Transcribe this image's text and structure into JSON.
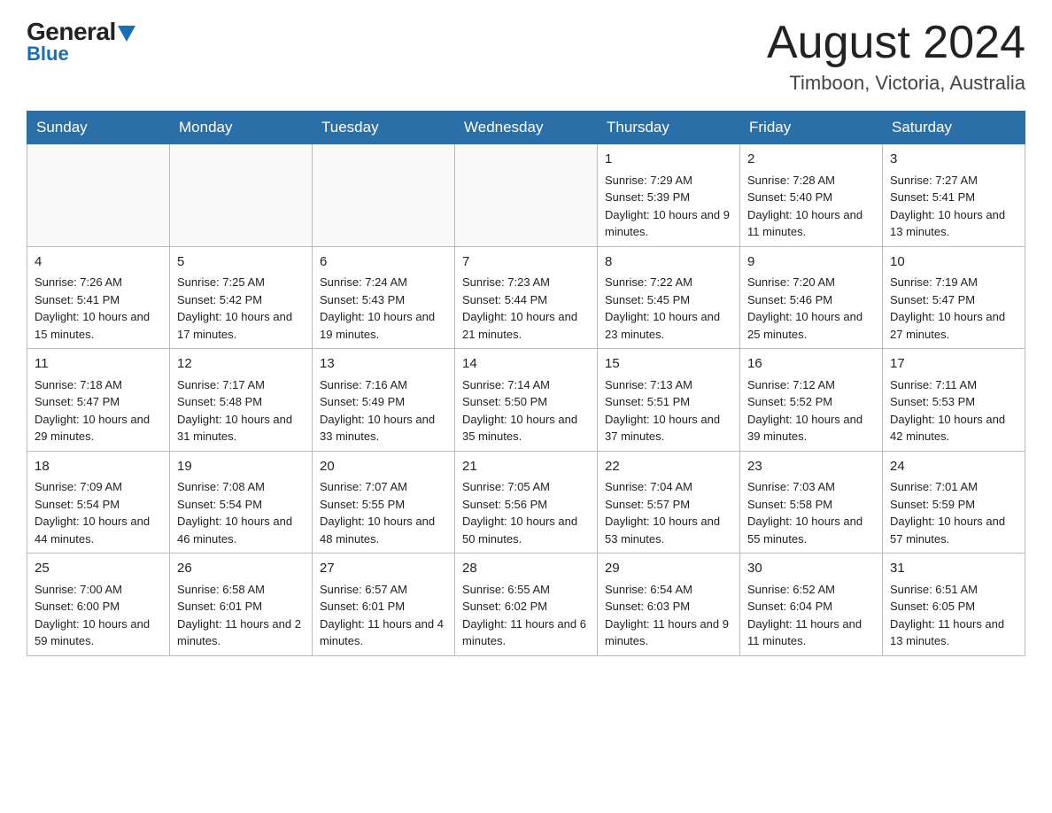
{
  "header": {
    "logo_general": "General",
    "logo_blue": "Blue",
    "month_title": "August 2024",
    "location": "Timboon, Victoria, Australia"
  },
  "days_of_week": [
    "Sunday",
    "Monday",
    "Tuesday",
    "Wednesday",
    "Thursday",
    "Friday",
    "Saturday"
  ],
  "weeks": [
    [
      {
        "day": "",
        "info": ""
      },
      {
        "day": "",
        "info": ""
      },
      {
        "day": "",
        "info": ""
      },
      {
        "day": "",
        "info": ""
      },
      {
        "day": "1",
        "info": "Sunrise: 7:29 AM\nSunset: 5:39 PM\nDaylight: 10 hours and 9 minutes."
      },
      {
        "day": "2",
        "info": "Sunrise: 7:28 AM\nSunset: 5:40 PM\nDaylight: 10 hours and 11 minutes."
      },
      {
        "day": "3",
        "info": "Sunrise: 7:27 AM\nSunset: 5:41 PM\nDaylight: 10 hours and 13 minutes."
      }
    ],
    [
      {
        "day": "4",
        "info": "Sunrise: 7:26 AM\nSunset: 5:41 PM\nDaylight: 10 hours and 15 minutes."
      },
      {
        "day": "5",
        "info": "Sunrise: 7:25 AM\nSunset: 5:42 PM\nDaylight: 10 hours and 17 minutes."
      },
      {
        "day": "6",
        "info": "Sunrise: 7:24 AM\nSunset: 5:43 PM\nDaylight: 10 hours and 19 minutes."
      },
      {
        "day": "7",
        "info": "Sunrise: 7:23 AM\nSunset: 5:44 PM\nDaylight: 10 hours and 21 minutes."
      },
      {
        "day": "8",
        "info": "Sunrise: 7:22 AM\nSunset: 5:45 PM\nDaylight: 10 hours and 23 minutes."
      },
      {
        "day": "9",
        "info": "Sunrise: 7:20 AM\nSunset: 5:46 PM\nDaylight: 10 hours and 25 minutes."
      },
      {
        "day": "10",
        "info": "Sunrise: 7:19 AM\nSunset: 5:47 PM\nDaylight: 10 hours and 27 minutes."
      }
    ],
    [
      {
        "day": "11",
        "info": "Sunrise: 7:18 AM\nSunset: 5:47 PM\nDaylight: 10 hours and 29 minutes."
      },
      {
        "day": "12",
        "info": "Sunrise: 7:17 AM\nSunset: 5:48 PM\nDaylight: 10 hours and 31 minutes."
      },
      {
        "day": "13",
        "info": "Sunrise: 7:16 AM\nSunset: 5:49 PM\nDaylight: 10 hours and 33 minutes."
      },
      {
        "day": "14",
        "info": "Sunrise: 7:14 AM\nSunset: 5:50 PM\nDaylight: 10 hours and 35 minutes."
      },
      {
        "day": "15",
        "info": "Sunrise: 7:13 AM\nSunset: 5:51 PM\nDaylight: 10 hours and 37 minutes."
      },
      {
        "day": "16",
        "info": "Sunrise: 7:12 AM\nSunset: 5:52 PM\nDaylight: 10 hours and 39 minutes."
      },
      {
        "day": "17",
        "info": "Sunrise: 7:11 AM\nSunset: 5:53 PM\nDaylight: 10 hours and 42 minutes."
      }
    ],
    [
      {
        "day": "18",
        "info": "Sunrise: 7:09 AM\nSunset: 5:54 PM\nDaylight: 10 hours and 44 minutes."
      },
      {
        "day": "19",
        "info": "Sunrise: 7:08 AM\nSunset: 5:54 PM\nDaylight: 10 hours and 46 minutes."
      },
      {
        "day": "20",
        "info": "Sunrise: 7:07 AM\nSunset: 5:55 PM\nDaylight: 10 hours and 48 minutes."
      },
      {
        "day": "21",
        "info": "Sunrise: 7:05 AM\nSunset: 5:56 PM\nDaylight: 10 hours and 50 minutes."
      },
      {
        "day": "22",
        "info": "Sunrise: 7:04 AM\nSunset: 5:57 PM\nDaylight: 10 hours and 53 minutes."
      },
      {
        "day": "23",
        "info": "Sunrise: 7:03 AM\nSunset: 5:58 PM\nDaylight: 10 hours and 55 minutes."
      },
      {
        "day": "24",
        "info": "Sunrise: 7:01 AM\nSunset: 5:59 PM\nDaylight: 10 hours and 57 minutes."
      }
    ],
    [
      {
        "day": "25",
        "info": "Sunrise: 7:00 AM\nSunset: 6:00 PM\nDaylight: 10 hours and 59 minutes."
      },
      {
        "day": "26",
        "info": "Sunrise: 6:58 AM\nSunset: 6:01 PM\nDaylight: 11 hours and 2 minutes."
      },
      {
        "day": "27",
        "info": "Sunrise: 6:57 AM\nSunset: 6:01 PM\nDaylight: 11 hours and 4 minutes."
      },
      {
        "day": "28",
        "info": "Sunrise: 6:55 AM\nSunset: 6:02 PM\nDaylight: 11 hours and 6 minutes."
      },
      {
        "day": "29",
        "info": "Sunrise: 6:54 AM\nSunset: 6:03 PM\nDaylight: 11 hours and 9 minutes."
      },
      {
        "day": "30",
        "info": "Sunrise: 6:52 AM\nSunset: 6:04 PM\nDaylight: 11 hours and 11 minutes."
      },
      {
        "day": "31",
        "info": "Sunrise: 6:51 AM\nSunset: 6:05 PM\nDaylight: 11 hours and 13 minutes."
      }
    ]
  ]
}
